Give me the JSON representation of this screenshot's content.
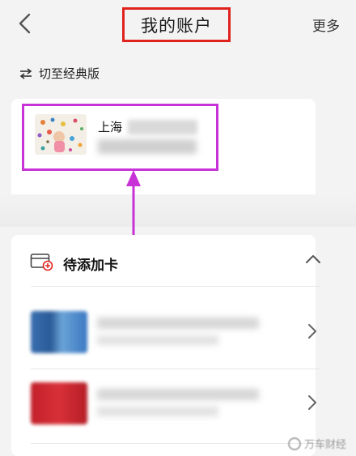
{
  "header": {
    "title": "我的账户",
    "more_label": "更多",
    "back_icon": "chevron-left-icon"
  },
  "switch": {
    "label": "切至经典版",
    "icon": "swap-arrows-icon"
  },
  "account": {
    "name_prefix": "上海"
  },
  "pending_cards": {
    "title": "待添加卡",
    "icon": "card-add-icon",
    "collapse_icon": "chevron-up-icon"
  },
  "colors": {
    "highlight_title": "#e0221f",
    "highlight_account": "#c733d6",
    "card_blue": "#3a6fb0",
    "card_red": "#c2202a"
  },
  "watermark": {
    "text": "万车财经"
  }
}
